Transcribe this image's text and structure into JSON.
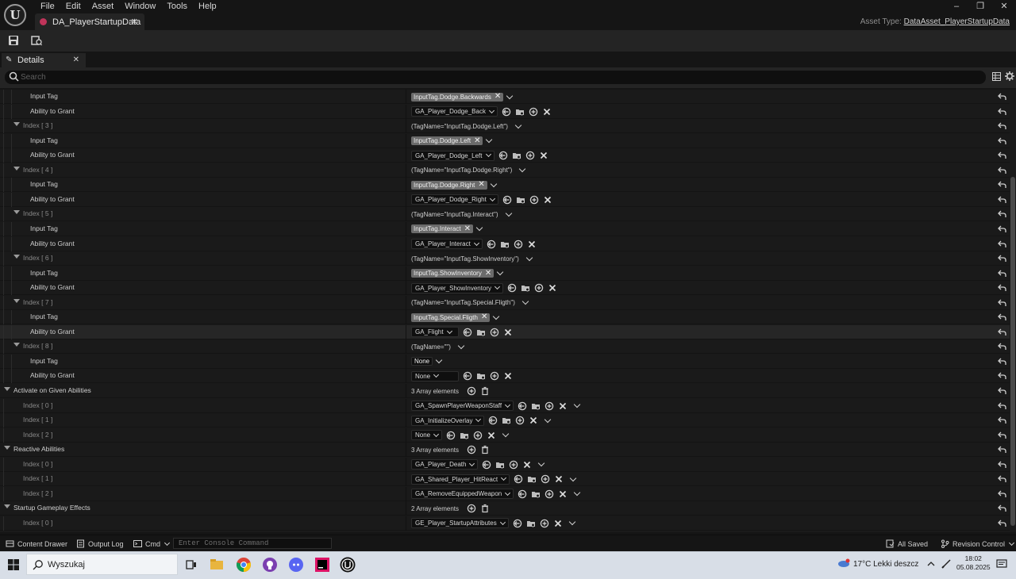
{
  "app": {
    "menu": [
      "File",
      "Edit",
      "Asset",
      "Window",
      "Tools",
      "Help"
    ],
    "asset_tab_title": "DA_PlayerStartupData",
    "asset_type_label": "Asset Type:",
    "asset_type_value": "DataAsset_PlayerStartupData"
  },
  "details": {
    "tab_label": "Details",
    "search_placeholder": "Search"
  },
  "rows": [
    {
      "name": "Input Tag",
      "kind": "tag",
      "value": "InputTag.Dodge.Backwards"
    },
    {
      "name": "Ability to Grant",
      "kind": "ability",
      "value": "GA_Player_Dodge_Back"
    },
    {
      "name": "Index [ 3 ]",
      "kind": "index",
      "value": "(TagName=\"InputTag.Dodge.Left\")"
    },
    {
      "name": "Input Tag",
      "kind": "tag",
      "value": "InputTag.Dodge.Left"
    },
    {
      "name": "Ability to Grant",
      "kind": "ability",
      "value": "GA_Player_Dodge_Left"
    },
    {
      "name": "Index [ 4 ]",
      "kind": "index",
      "value": "(TagName=\"InputTag.Dodge.Right\")"
    },
    {
      "name": "Input Tag",
      "kind": "tag",
      "value": "InputTag.Dodge.Right"
    },
    {
      "name": "Ability to Grant",
      "kind": "ability",
      "value": "GA_Player_Dodge_Right"
    },
    {
      "name": "Index [ 5 ]",
      "kind": "index",
      "value": "(TagName=\"InputTag.Interact\")"
    },
    {
      "name": "Input Tag",
      "kind": "tag",
      "value": "InputTag.Interact"
    },
    {
      "name": "Ability to Grant",
      "kind": "ability",
      "value": "GA_Player_Interact"
    },
    {
      "name": "Index [ 6 ]",
      "kind": "index",
      "value": "(TagName=\"InputTag.ShowInventory\")"
    },
    {
      "name": "Input Tag",
      "kind": "tag",
      "value": "InputTag.ShowInventory"
    },
    {
      "name": "Ability to Grant",
      "kind": "ability",
      "value": "GA_Player_ShowInventory"
    },
    {
      "name": "Index [ 7 ]",
      "kind": "index",
      "value": "(TagName=\"InputTag.Special.Fligth\")"
    },
    {
      "name": "Input Tag",
      "kind": "tag",
      "value": "InputTag.Special.Fligth"
    },
    {
      "name": "Ability to Grant",
      "kind": "ability",
      "value": "GA_Flight",
      "highlight": true
    },
    {
      "name": "Index [ 8 ]",
      "kind": "index",
      "value": "(TagName=\"\")"
    },
    {
      "name": "Input Tag",
      "kind": "tagnone",
      "value": "None"
    },
    {
      "name": "Ability to Grant",
      "kind": "ability",
      "value": "None"
    },
    {
      "name": "Activate on Given Abilities",
      "kind": "category",
      "value": "3 Array elements"
    },
    {
      "name": "Index [ 0 ]",
      "kind": "arrayitem",
      "value": "GA_SpawnPlayerWeaponStaff"
    },
    {
      "name": "Index [ 1 ]",
      "kind": "arrayitem",
      "value": "GA_InitializeOverlay"
    },
    {
      "name": "Index [ 2 ]",
      "kind": "arrayitem",
      "value": "None"
    },
    {
      "name": "Reactive Abilities",
      "kind": "category",
      "value": "3 Array elements"
    },
    {
      "name": "Index [ 0 ]",
      "kind": "arrayitem",
      "value": "GA_Player_Death"
    },
    {
      "name": "Index [ 1 ]",
      "kind": "arrayitem",
      "value": "GA_Shared_Player_HitReact"
    },
    {
      "name": "Index [ 2 ]",
      "kind": "arrayitem",
      "value": "GA_RemoveEquippedWeapon"
    },
    {
      "name": "Startup Gameplay Effects",
      "kind": "category",
      "value": "2 Array elements"
    },
    {
      "name": "Index [ 0 ]",
      "kind": "arrayitem",
      "value": "GE_Player_StartupAttributes"
    }
  ],
  "statusbar": {
    "content_drawer": "Content Drawer",
    "output_log": "Output Log",
    "cmd": "Cmd",
    "console_placeholder": "Enter Console Command",
    "all_saved": "All Saved",
    "revision_control": "Revision Control"
  },
  "taskbar": {
    "search_label": "Wyszukaj",
    "weather": "17°C  Lekki deszcz",
    "time": "18:02",
    "date": "05.08.2025"
  },
  "colors": {
    "panel": "#242424",
    "row": "#1a1a1a",
    "tag_chip": "#6b6b6b",
    "asset_dot": "#c0345a"
  }
}
